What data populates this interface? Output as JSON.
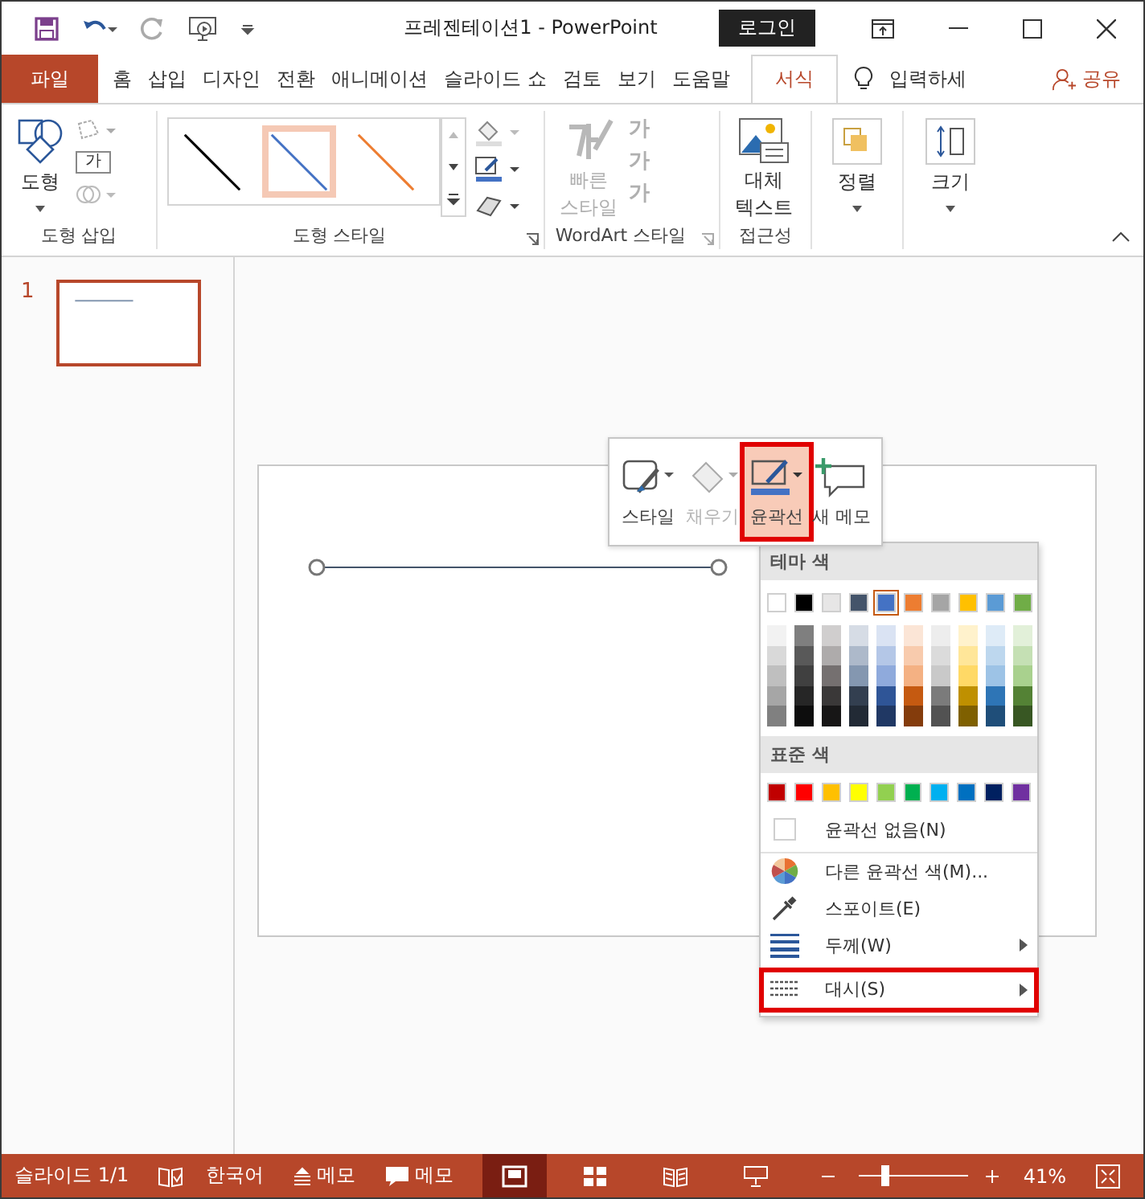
{
  "window": {
    "title": "프레젠테이션1  -  PowerPoint",
    "login": "로그인"
  },
  "tabs": [
    {
      "label": "파일",
      "kind": "file",
      "selected": false
    },
    {
      "label": "홈",
      "kind": "tab",
      "selected": false
    },
    {
      "label": "삽입",
      "kind": "tab",
      "selected": false
    },
    {
      "label": "디자인",
      "kind": "tab",
      "selected": false
    },
    {
      "label": "전환",
      "kind": "tab",
      "selected": false
    },
    {
      "label": "애니메이션",
      "kind": "tab",
      "selected": false
    },
    {
      "label": "슬라이드 쇼",
      "kind": "tab",
      "selected": false
    },
    {
      "label": "검토",
      "kind": "tab",
      "selected": false
    },
    {
      "label": "보기",
      "kind": "tab",
      "selected": false
    },
    {
      "label": "도움말",
      "kind": "tab",
      "selected": false
    },
    {
      "label": "서식",
      "kind": "tab",
      "selected": true
    }
  ],
  "tell_me": "입력하세",
  "share": "공유",
  "ribbon": {
    "shape_insert": {
      "label": "도형 삽입",
      "button": "도형",
      "small_text": "가"
    },
    "shape_styles": {
      "label": "도형 스타일",
      "styles": [
        {
          "color": "#000000",
          "selected": false
        },
        {
          "color": "#4472c4",
          "selected": true
        },
        {
          "color": "#ed7d31",
          "selected": false
        }
      ]
    },
    "wordart": {
      "label": "WordArt 스타일",
      "button_lines": [
        "빠른",
        "스타일"
      ],
      "disabled": true,
      "small": [
        "가",
        "가",
        "가"
      ]
    },
    "accessibility": {
      "label": "접근성",
      "button_lines": [
        "대체",
        "텍스트"
      ]
    },
    "arrange": {
      "button": "정렬"
    },
    "size": {
      "button": "크기"
    }
  },
  "slides": [
    {
      "number": "1",
      "selected": true
    }
  ],
  "mini_toolbar": [
    {
      "label": "스타일",
      "kind": "style",
      "disabled": false,
      "selected": false,
      "highlighted": false
    },
    {
      "label": "채우기",
      "kind": "fill",
      "disabled": true,
      "selected": false,
      "highlighted": false
    },
    {
      "label": "윤곽선",
      "kind": "outline",
      "disabled": false,
      "selected": true,
      "highlighted": true
    },
    {
      "label": "새 메모",
      "kind": "comment",
      "disabled": false,
      "selected": false,
      "highlighted": false
    }
  ],
  "outline_menu": {
    "theme_header": "테마 색",
    "theme_colors": [
      {
        "color": "#ffffff",
        "selected": false,
        "shades": [
          {
            "color": "#f2f2f2"
          },
          {
            "color": "#d9d9d9"
          },
          {
            "color": "#bfbfbf"
          },
          {
            "color": "#a6a6a6"
          },
          {
            "color": "#808080"
          }
        ]
      },
      {
        "color": "#000000",
        "selected": false,
        "shades": [
          {
            "color": "#7f7f7f"
          },
          {
            "color": "#595959"
          },
          {
            "color": "#404040"
          },
          {
            "color": "#262626"
          },
          {
            "color": "#0d0d0d"
          }
        ]
      },
      {
        "color": "#e7e6e6",
        "selected": false,
        "shades": [
          {
            "color": "#d0cece"
          },
          {
            "color": "#aeabab"
          },
          {
            "color": "#757070"
          },
          {
            "color": "#3a3838"
          },
          {
            "color": "#171616"
          }
        ]
      },
      {
        "color": "#44546a",
        "selected": false,
        "shades": [
          {
            "color": "#d6dce5"
          },
          {
            "color": "#adb9ca"
          },
          {
            "color": "#8497b0"
          },
          {
            "color": "#333f50"
          },
          {
            "color": "#222a35"
          }
        ]
      },
      {
        "color": "#4472c4",
        "selected": true,
        "shades": [
          {
            "color": "#dae3f3"
          },
          {
            "color": "#b4c7e7"
          },
          {
            "color": "#8faadc"
          },
          {
            "color": "#2f5597"
          },
          {
            "color": "#203864"
          }
        ]
      },
      {
        "color": "#ed7d31",
        "selected": false,
        "shades": [
          {
            "color": "#fbe5d6"
          },
          {
            "color": "#f8cbad"
          },
          {
            "color": "#f4b183"
          },
          {
            "color": "#c55a11"
          },
          {
            "color": "#843c0c"
          }
        ]
      },
      {
        "color": "#a5a5a5",
        "selected": false,
        "shades": [
          {
            "color": "#ededed"
          },
          {
            "color": "#dbdbdb"
          },
          {
            "color": "#c9c9c9"
          },
          {
            "color": "#7b7b7b"
          },
          {
            "color": "#525252"
          }
        ]
      },
      {
        "color": "#ffc000",
        "selected": false,
        "shades": [
          {
            "color": "#fff2cc"
          },
          {
            "color": "#ffe699"
          },
          {
            "color": "#ffd966"
          },
          {
            "color": "#bf9000"
          },
          {
            "color": "#7f6000"
          }
        ]
      },
      {
        "color": "#5b9bd5",
        "selected": false,
        "shades": [
          {
            "color": "#deebf7"
          },
          {
            "color": "#bdd7ee"
          },
          {
            "color": "#9dc3e6"
          },
          {
            "color": "#2e75b6"
          },
          {
            "color": "#1f4e79"
          }
        ]
      },
      {
        "color": "#70ad47",
        "selected": false,
        "shades": [
          {
            "color": "#e2f0d9"
          },
          {
            "color": "#c5e0b4"
          },
          {
            "color": "#a9d18e"
          },
          {
            "color": "#548235"
          },
          {
            "color": "#385723"
          }
        ]
      }
    ],
    "standard_header": "표준 색",
    "standard_colors": [
      {
        "color": "#c00000"
      },
      {
        "color": "#ff0000"
      },
      {
        "color": "#ffc000"
      },
      {
        "color": "#ffff00"
      },
      {
        "color": "#92d050"
      },
      {
        "color": "#00b050"
      },
      {
        "color": "#00b0f0"
      },
      {
        "color": "#0070c0"
      },
      {
        "color": "#002060"
      },
      {
        "color": "#7030a0"
      }
    ],
    "items": [
      {
        "kind": "no-outline",
        "label": "윤곽선 없음(N)",
        "submenu": false,
        "highlighted": false
      },
      {
        "kind": "more-colors",
        "label": "다른 윤곽선 색(M)...",
        "submenu": false,
        "highlighted": false
      },
      {
        "kind": "eyedropper",
        "label": "스포이트(E)",
        "submenu": false,
        "highlighted": false
      },
      {
        "kind": "weight",
        "label": "두께(W)",
        "submenu": true,
        "highlighted": false
      },
      {
        "kind": "dash",
        "label": "대시(S)",
        "submenu": true,
        "highlighted": true
      }
    ]
  },
  "status_bar": {
    "slide_info": "슬라이드 1/1",
    "language": "한국어",
    "notes": "메모",
    "comments": "메모",
    "views": [
      {
        "kind": "normal",
        "selected": true
      },
      {
        "kind": "sorter",
        "selected": false
      },
      {
        "kind": "reading",
        "selected": false
      },
      {
        "kind": "slideshow",
        "selected": false
      }
    ],
    "zoom": {
      "level": 0.2,
      "reading": "41%"
    }
  }
}
